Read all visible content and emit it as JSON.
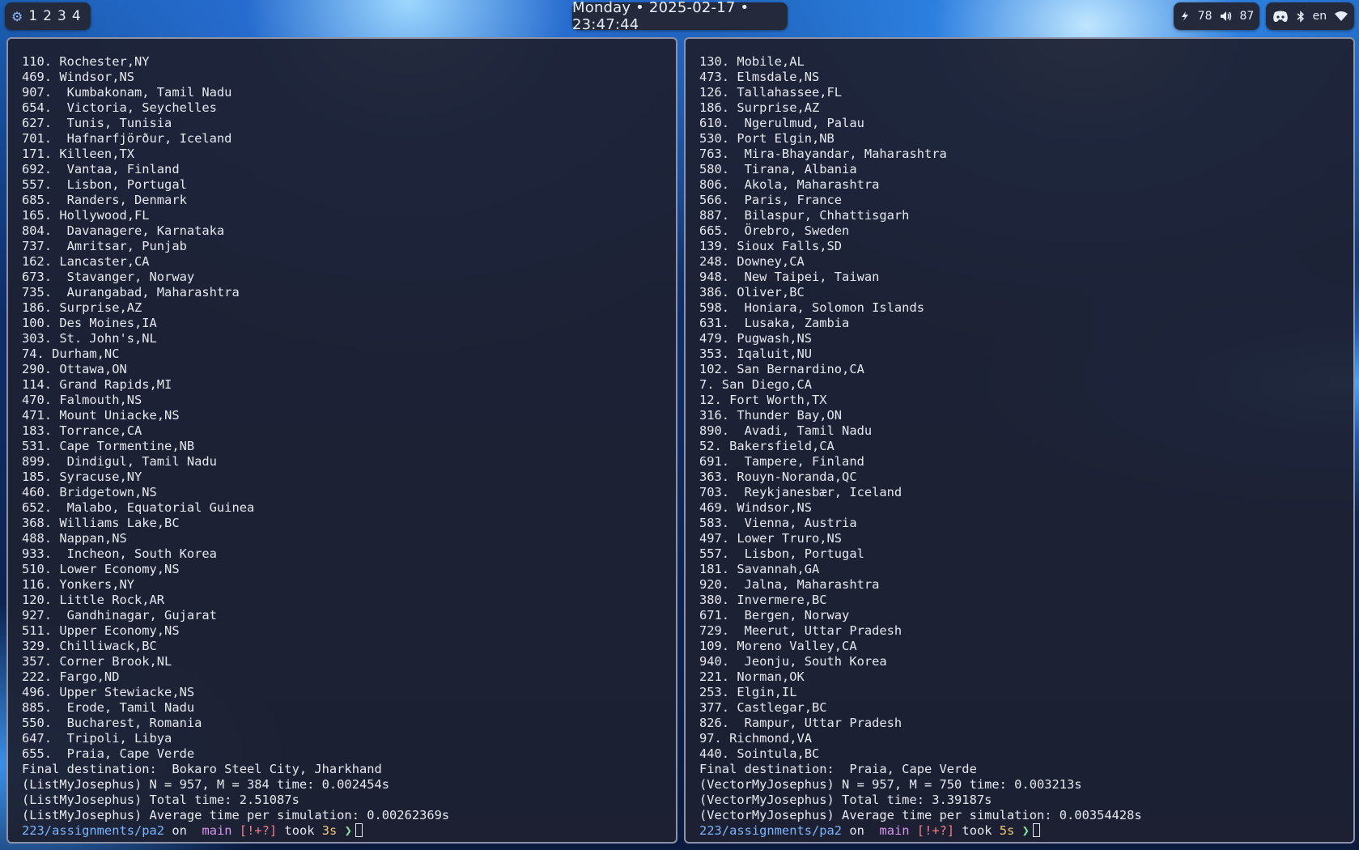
{
  "topbar": {
    "workspaces": [
      "1",
      "2",
      "3",
      "4"
    ],
    "clock": "Monday • 2025-02-17 • 23:47:44",
    "battery": "78",
    "volume": "87",
    "language": "en"
  },
  "left_terminal": {
    "lines": [
      "110. Rochester,NY",
      "469. Windsor,NS",
      "907.  Kumbakonam, Tamil Nadu",
      "654.  Victoria, Seychelles",
      "627.  Tunis, Tunisia",
      "701.  Hafnarfjörður, Iceland",
      "171. Killeen,TX",
      "692.  Vantaa, Finland",
      "557.  Lisbon, Portugal",
      "685.  Randers, Denmark",
      "165. Hollywood,FL",
      "804.  Davanagere, Karnataka",
      "737.  Amritsar, Punjab",
      "162. Lancaster,CA",
      "673.  Stavanger, Norway",
      "735.  Aurangabad, Maharashtra",
      "186. Surprise,AZ",
      "100. Des Moines,IA",
      "303. St. John's,NL",
      "74. Durham,NC",
      "290. Ottawa,ON",
      "114. Grand Rapids,MI",
      "470. Falmouth,NS",
      "471. Mount Uniacke,NS",
      "183. Torrance,CA",
      "531. Cape Tormentine,NB",
      "899.  Dindigul, Tamil Nadu",
      "185. Syracuse,NY",
      "460. Bridgetown,NS",
      "652.  Malabo, Equatorial Guinea",
      "368. Williams Lake,BC",
      "488. Nappan,NS",
      "933.  Incheon, South Korea",
      "510. Lower Economy,NS",
      "116. Yonkers,NY",
      "120. Little Rock,AR",
      "927.  Gandhinagar, Gujarat",
      "511. Upper Economy,NS",
      "329. Chilliwack,BC",
      "357. Corner Brook,NL",
      "222. Fargo,ND",
      "496. Upper Stewiacke,NS",
      "885.  Erode, Tamil Nadu",
      "550.  Bucharest, Romania",
      "647.  Tripoli, Libya",
      "655.  Praia, Cape Verde",
      "Final destination:  Bokaro Steel City, Jharkhand",
      "(ListMyJosephus) N = 957, M = 384 time: 0.002454s",
      "(ListMyJosephus) Total time: 2.51087s",
      "(ListMyJosephus) Average time per simulation: 0.00262369s"
    ],
    "prompt": {
      "path": "223/assignments/pa2",
      "on": "on",
      "branch": " main",
      "status": "[!+?]",
      "took": "took",
      "duration": "3s",
      "arrow": "❯"
    }
  },
  "right_terminal": {
    "lines": [
      "130. Mobile,AL",
      "473. Elmsdale,NS",
      "126. Tallahassee,FL",
      "186. Surprise,AZ",
      "610.  Ngerulmud, Palau",
      "530. Port Elgin,NB",
      "763.  Mira-Bhayandar, Maharashtra",
      "580.  Tirana, Albania",
      "806.  Akola, Maharashtra",
      "566.  Paris, France",
      "887.  Bilaspur, Chhattisgarh",
      "665.  Örebro, Sweden",
      "139. Sioux Falls,SD",
      "248. Downey,CA",
      "948.  New Taipei, Taiwan",
      "386. Oliver,BC",
      "598.  Honiara, Solomon Islands",
      "631.  Lusaka, Zambia",
      "479. Pugwash,NS",
      "353. Iqaluit,NU",
      "102. San Bernardino,CA",
      "7. San Diego,CA",
      "12. Fort Worth,TX",
      "316. Thunder Bay,ON",
      "890.  Avadi, Tamil Nadu",
      "52. Bakersfield,CA",
      "691.  Tampere, Finland",
      "363. Rouyn-Noranda,QC",
      "703.  Reykjanesbær, Iceland",
      "469. Windsor,NS",
      "583.  Vienna, Austria",
      "497. Lower Truro,NS",
      "557.  Lisbon, Portugal",
      "181. Savannah,GA",
      "920.  Jalna, Maharashtra",
      "380. Invermere,BC",
      "671.  Bergen, Norway",
      "729.  Meerut, Uttar Pradesh",
      "109. Moreno Valley,CA",
      "940.  Jeonju, South Korea",
      "221. Norman,OK",
      "253. Elgin,IL",
      "377. Castlegar,BC",
      "826.  Rampur, Uttar Pradesh",
      "97. Richmond,VA",
      "440. Sointula,BC",
      "Final destination:  Praia, Cape Verde",
      "(VectorMyJosephus) N = 957, M = 750 time: 0.003213s",
      "(VectorMyJosephus) Total time: 3.39187s",
      "(VectorMyJosephus) Average time per simulation: 0.00354428s"
    ],
    "prompt": {
      "path": "223/assignments/pa2",
      "on": "on",
      "branch": " main",
      "status": "[!+?]",
      "took": "took",
      "duration": "5s",
      "arrow": "❯"
    }
  }
}
